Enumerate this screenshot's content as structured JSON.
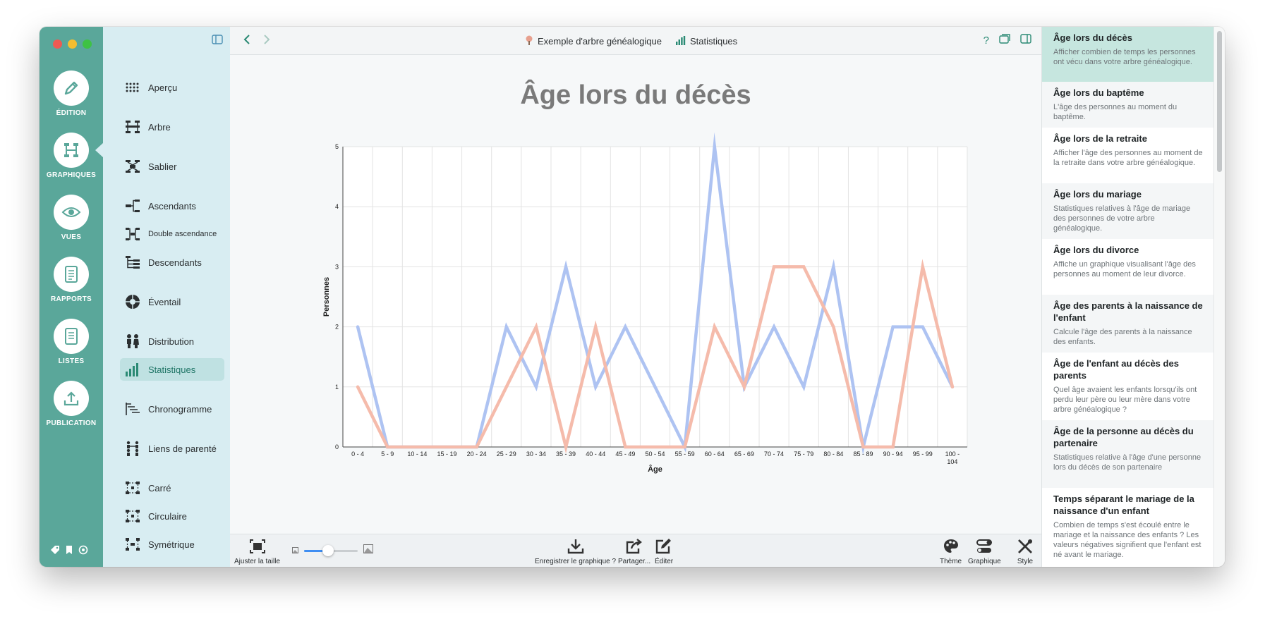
{
  "toolbar": {
    "items": [
      {
        "label": "ÉDITION"
      },
      {
        "label": "GRAPHIQUES"
      },
      {
        "label": "VUES"
      },
      {
        "label": "RAPPORTS"
      },
      {
        "label": "LISTES"
      },
      {
        "label": "PUBLICATION"
      }
    ],
    "active_index": 1
  },
  "sidebar": {
    "items": [
      {
        "label": "Aperçu"
      },
      {
        "label": "Arbre"
      },
      {
        "label": "Sablier"
      },
      {
        "label": "Ascendants"
      },
      {
        "label": "Double ascendance"
      },
      {
        "label": "Descendants"
      },
      {
        "label": "Éventail"
      },
      {
        "label": "Distribution"
      },
      {
        "label": "Statistiques"
      },
      {
        "label": "Chronogramme"
      },
      {
        "label": "Liens de parenté"
      },
      {
        "label": "Carré"
      },
      {
        "label": "Circulaire"
      },
      {
        "label": "Symétrique"
      }
    ],
    "active_index": 8
  },
  "header": {
    "crumb_tree": "Exemple d'arbre généalogique",
    "crumb_view": "Statistiques",
    "help_label": "?"
  },
  "chart_title": "Âge lors du décès",
  "chart_data": {
    "type": "line",
    "xlabel": "Âge",
    "ylabel": "Personnes",
    "ylim": [
      0,
      5
    ],
    "yticks": [
      "0",
      "1",
      "2",
      "3",
      "4",
      "5"
    ],
    "grid": true,
    "categories": [
      "0 - 4",
      "5 - 9",
      "10 - 14",
      "15 - 19",
      "20 - 24",
      "25 - 29",
      "30 - 34",
      "35 - 39",
      "40 - 44",
      "45 - 49",
      "50 - 54",
      "55 - 59",
      "60 - 64",
      "65 - 69",
      "70 - 74",
      "75 - 79",
      "80 - 84",
      "85 - 89",
      "90 - 94",
      "95 - 99",
      "100 - 104"
    ],
    "series": [
      {
        "color": "#aec3f2",
        "values": [
          2,
          0,
          0,
          0,
          0,
          2,
          1,
          3,
          1,
          2,
          1,
          0,
          5,
          1,
          2,
          1,
          3,
          0,
          2,
          2,
          1
        ]
      },
      {
        "color": "#f5bbab",
        "values": [
          1,
          0,
          0,
          0,
          0,
          1,
          2,
          0,
          2,
          0,
          0,
          0,
          2,
          1,
          3,
          3,
          2,
          0,
          0,
          3,
          1
        ]
      }
    ]
  },
  "bottombar": {
    "fit_label": "Ajuster la taille",
    "zoom": 0.45,
    "save_label": "Enregistrer le graphique ?",
    "share_label": "Partager...",
    "edit_label": "Éditer",
    "theme_label": "Thème",
    "chart_label": "Graphique",
    "style_label": "Style"
  },
  "rpanel": {
    "items": [
      {
        "title": "Âge lors du décès",
        "desc": "Afficher combien de temps les personnes ont vécu dans votre arbre généalogique."
      },
      {
        "title": "Âge lors du baptême",
        "desc": "L'âge des personnes au moment du baptême."
      },
      {
        "title": "Âge lors de la retraite",
        "desc": "Afficher l'âge des personnes au moment de la retraite dans votre arbre généalogique."
      },
      {
        "title": "Âge lors du mariage",
        "desc": "Statistiques relatives à l'âge de mariage des personnes de votre arbre généalogique."
      },
      {
        "title": "Âge lors du divorce",
        "desc": "Affiche un graphique visualisant l'âge des personnes au moment de leur divorce."
      },
      {
        "title": "Âge des parents à la naissance de l'enfant",
        "desc": "Calcule l'âge des parents à la naissance des enfants."
      },
      {
        "title": "Âge de l'enfant au décès des parents",
        "desc": "Quel âge avaient les enfants lorsqu'ils ont perdu leur père ou leur mère dans votre arbre généalogique ?"
      },
      {
        "title": "Âge de la personne au décès du partenaire",
        "desc": "Statistiques relative à l'âge d'une personne lors du décès de son partenaire"
      },
      {
        "title": "Temps séparant le mariage de la naissance d'un enfant",
        "desc": "Combien de temps s'est écoulé entre le mariage et la naissance des enfants ? Les valeurs négatives signifient que l'enfant est né avant le mariage."
      }
    ],
    "active_index": 0
  }
}
